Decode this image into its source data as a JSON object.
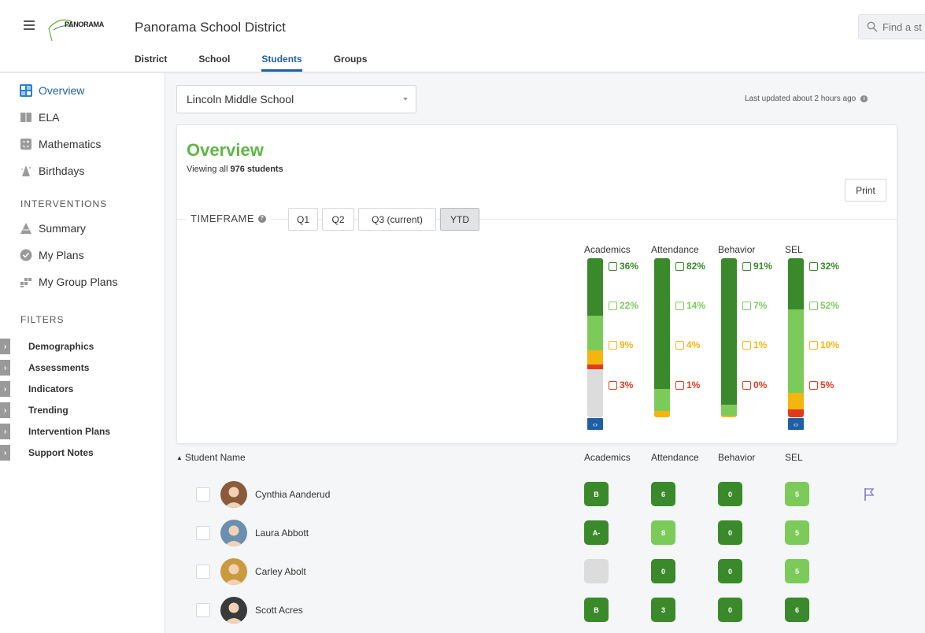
{
  "header": {
    "logo_text": "PANORAMA",
    "district_name": "Panorama School District",
    "search_placeholder": "Find a st",
    "tabs": [
      {
        "label": "District",
        "active": false
      },
      {
        "label": "School",
        "active": false
      },
      {
        "label": "Students",
        "active": true
      },
      {
        "label": "Groups",
        "active": false
      }
    ]
  },
  "sidebar": {
    "items": [
      {
        "label": "Overview",
        "icon": "overview-grid-icon",
        "active": true
      },
      {
        "label": "ELA",
        "icon": "book-icon",
        "active": false
      },
      {
        "label": "Mathematics",
        "icon": "calculator-icon",
        "active": false
      },
      {
        "label": "Birthdays",
        "icon": "party-hat-icon",
        "active": false
      }
    ],
    "interventions_header": "INTERVENTIONS",
    "intervention_items": [
      {
        "label": "Summary",
        "icon": "pyramid-icon"
      },
      {
        "label": "My Plans",
        "icon": "check-circle-icon"
      },
      {
        "label": "My Group Plans",
        "icon": "group-blocks-icon"
      }
    ],
    "filters_header": "FILTERS",
    "filters": [
      "Demographics",
      "Assessments",
      "Indicators",
      "Trending",
      "Intervention Plans",
      "Support Notes"
    ]
  },
  "main": {
    "school_select": "Lincoln Middle School",
    "last_updated": "Last updated about 2 hours ago",
    "overview_title": "Overview",
    "viewing_prefix": "Viewing all ",
    "viewing_count": "976 students",
    "print_label": "Print",
    "timeframe_label": "TIMEFRAME",
    "timeframes": [
      {
        "label": "Q1",
        "active": false
      },
      {
        "label": "Q2",
        "active": false
      },
      {
        "label": "Q3 (current)",
        "active": false
      },
      {
        "label": "YTD",
        "active": true
      }
    ]
  },
  "colors": {
    "dark_green": "#3a8a2b",
    "light_green": "#7ccb5a",
    "yellow": "#f5b50f",
    "red": "#e23b1c",
    "gray": "#dcdcdc",
    "accent_blue": "#1f5fa6"
  },
  "distribution": [
    {
      "label": "Academics",
      "pcts": [
        "36%",
        "22%",
        "9%",
        "3%"
      ],
      "fractions": [
        0.36,
        0.22,
        0.09,
        0.03
      ],
      "gray_fraction": 0.3,
      "expand": true
    },
    {
      "label": "Attendance",
      "pcts": [
        "82%",
        "14%",
        "4%",
        "1%"
      ],
      "fractions": [
        0.82,
        0.14,
        0.04,
        0.0
      ],
      "gray_fraction": 0,
      "expand": false
    },
    {
      "label": "Behavior",
      "pcts": [
        "91%",
        "7%",
        "1%",
        "0%"
      ],
      "fractions": [
        0.91,
        0.07,
        0.01,
        0.0
      ],
      "gray_fraction": 0,
      "expand": false
    },
    {
      "label": "SEL",
      "pcts": [
        "32%",
        "52%",
        "10%",
        "5%"
      ],
      "fractions": [
        0.32,
        0.52,
        0.1,
        0.05
      ],
      "gray_fraction": 0,
      "expand": true
    }
  ],
  "table": {
    "name_header": "Student Name",
    "headers": [
      "Academics",
      "Attendance",
      "Behavior",
      "SEL"
    ],
    "rows": [
      {
        "name": "Cynthia Aanderud",
        "values": [
          "B",
          "6",
          "0",
          "5"
        ],
        "tones": [
          "dark",
          "dark",
          "dark",
          "light"
        ],
        "flag": true,
        "avatar_color": "#8a5a3a"
      },
      {
        "name": "Laura Abbott",
        "values": [
          "A-",
          "8",
          "0",
          "5"
        ],
        "tones": [
          "dark",
          "light",
          "dark",
          "light"
        ],
        "flag": false,
        "avatar_color": "#6a8fb0"
      },
      {
        "name": "Carley Abolt",
        "values": [
          "",
          "0",
          "0",
          "5"
        ],
        "tones": [
          "empty",
          "dark",
          "dark",
          "light"
        ],
        "flag": false,
        "avatar_color": "#c99a3e"
      },
      {
        "name": "Scott Acres",
        "values": [
          "B",
          "3",
          "0",
          "6"
        ],
        "tones": [
          "dark",
          "dark",
          "dark",
          "dark"
        ],
        "flag": false,
        "avatar_color": "#3a3a3a"
      }
    ]
  }
}
